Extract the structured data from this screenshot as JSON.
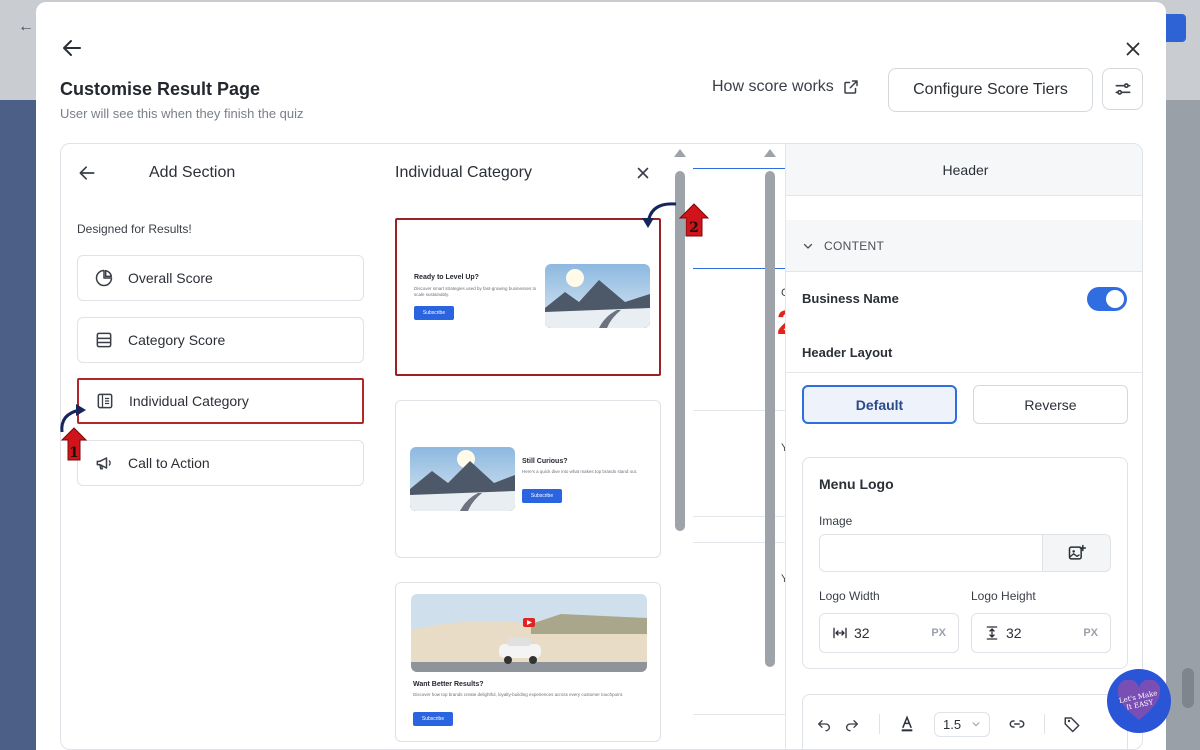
{
  "modal": {
    "title": "Customise Result Page",
    "subtitle": "User will see this when they finish the quiz",
    "how_score_link": "How score works",
    "configure_button": "Configure Score Tiers"
  },
  "add_section": {
    "title": "Add Section",
    "subtitle": "Designed for Results!",
    "items": [
      {
        "label": "Overall Score",
        "icon": "pie-chart-icon"
      },
      {
        "label": "Category Score",
        "icon": "list-box-icon"
      },
      {
        "label": "Individual Category",
        "icon": "document-list-icon",
        "selected": true
      },
      {
        "label": "Call to Action",
        "icon": "megaphone-icon"
      }
    ]
  },
  "individual_category": {
    "title": "Individual Category",
    "templates": [
      {
        "heading": "Ready to Level Up?",
        "text": "Discover smart strategies used by fast-growing businesses to scale sustainably.",
        "button": "Subscribe"
      },
      {
        "heading": "Still Curious?",
        "text": "Here's a quick dive into what makes top brands stand out.",
        "button": "Subscribe"
      },
      {
        "heading": "Want Better Results?",
        "text": "Discover how top brands create delightful, loyalty-building experiences across every customer touchpoint.",
        "button": "Subscribe"
      }
    ]
  },
  "preview": {
    "fragments": [
      "C",
      "2",
      "Y",
      "Y"
    ]
  },
  "settings": {
    "header_title": "Header",
    "content_label": "CONTENT",
    "business_name_label": "Business Name",
    "business_name_enabled": true,
    "header_layout_label": "Header Layout",
    "layout_default": "Default",
    "layout_reverse": "Reverse",
    "menu_logo_label": "Menu Logo",
    "image_label": "Image",
    "logo_width_label": "Logo Width",
    "logo_height_label": "Logo Height",
    "logo_width_value": "32",
    "logo_height_value": "32",
    "unit": "PX",
    "line_height_value": "1.5"
  },
  "annotations": {
    "marker1": "1",
    "marker2": "2",
    "badge_text": "Let's Make It EASY"
  },
  "colors": {
    "accent": "#2f6de0",
    "highlight": "#b3262a",
    "marker": "#d0141a"
  }
}
